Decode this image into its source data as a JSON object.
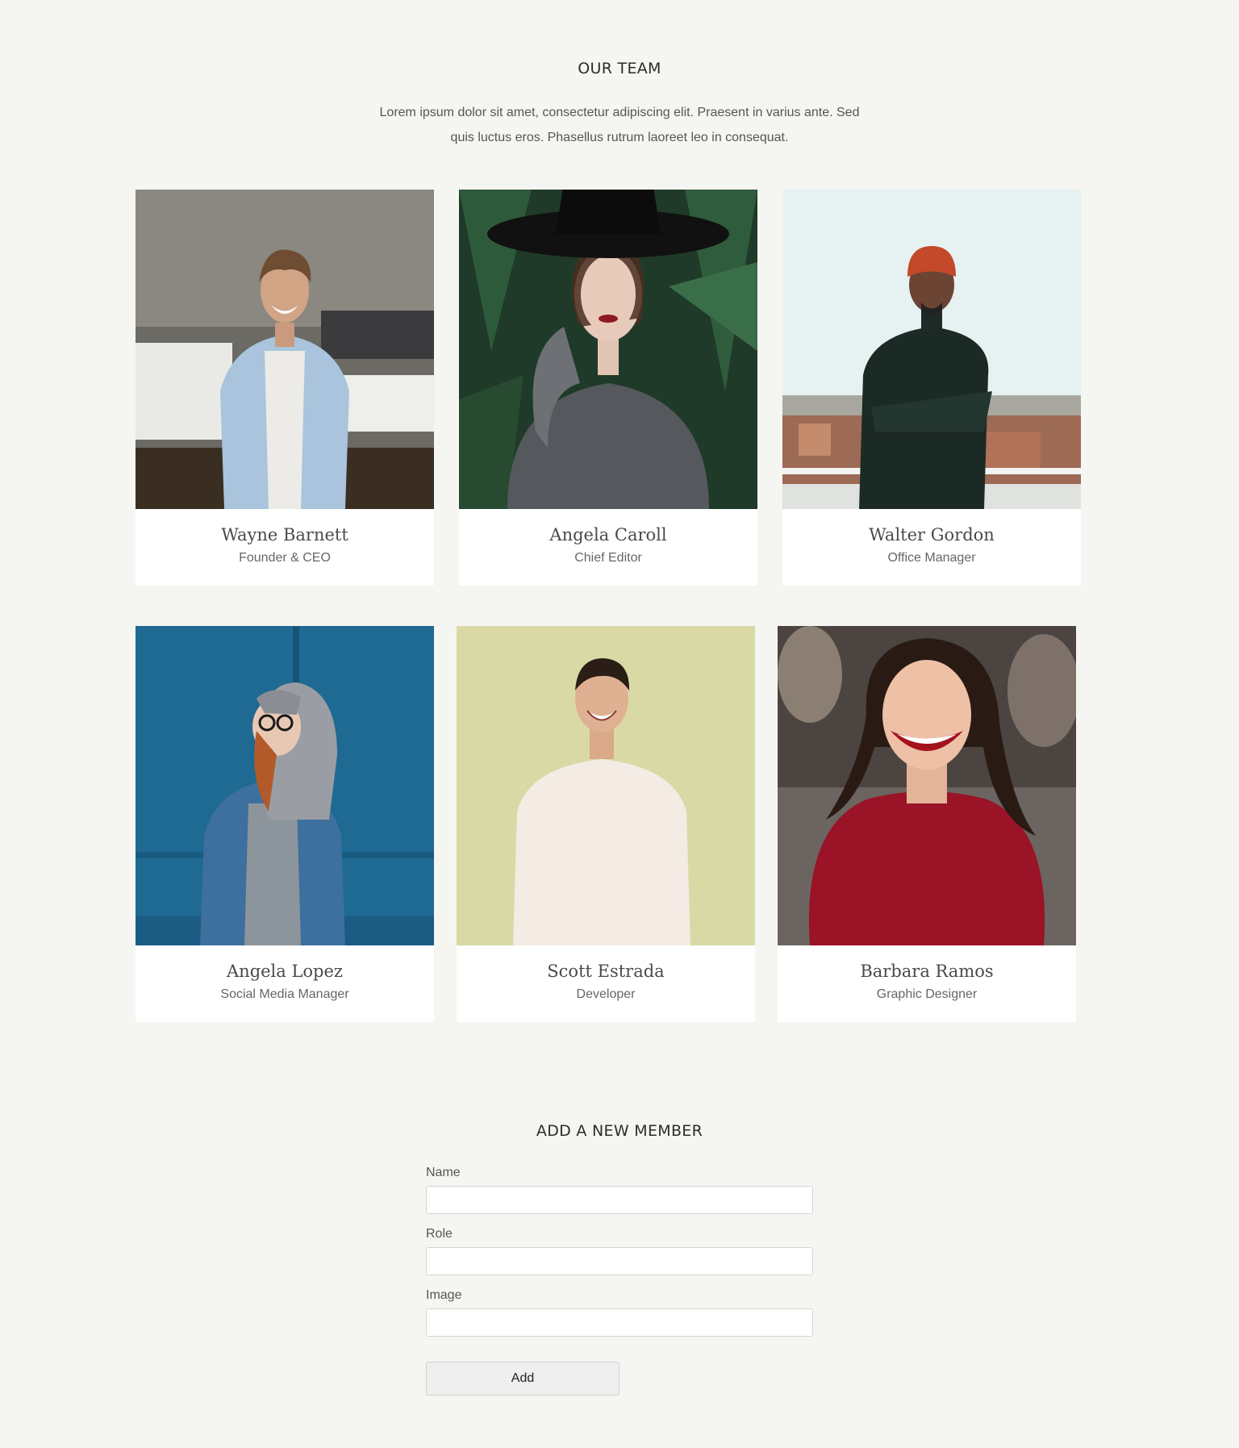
{
  "team": {
    "title": "OUR TEAM",
    "intro": "Lorem ipsum dolor sit amet, consectetur adipiscing elit. Praesent in varius ante. Sed quis luctus eros. Phasellus rutrum laoreet leo in consequat."
  },
  "members": [
    {
      "name": "Wayne Barnett",
      "role": "Founder & CEO"
    },
    {
      "name": "Angela Caroll",
      "role": "Chief Editor"
    },
    {
      "name": "Walter Gordon",
      "role": "Office Manager"
    },
    {
      "name": "Angela Lopez",
      "role": "Social Media Manager"
    },
    {
      "name": "Scott Estrada",
      "role": "Developer"
    },
    {
      "name": "Barbara Ramos",
      "role": "Graphic Designer"
    }
  ],
  "form": {
    "title": "ADD A NEW MEMBER",
    "name_label": "Name",
    "role_label": "Role",
    "image_label": "Image",
    "add_label": "Add"
  }
}
